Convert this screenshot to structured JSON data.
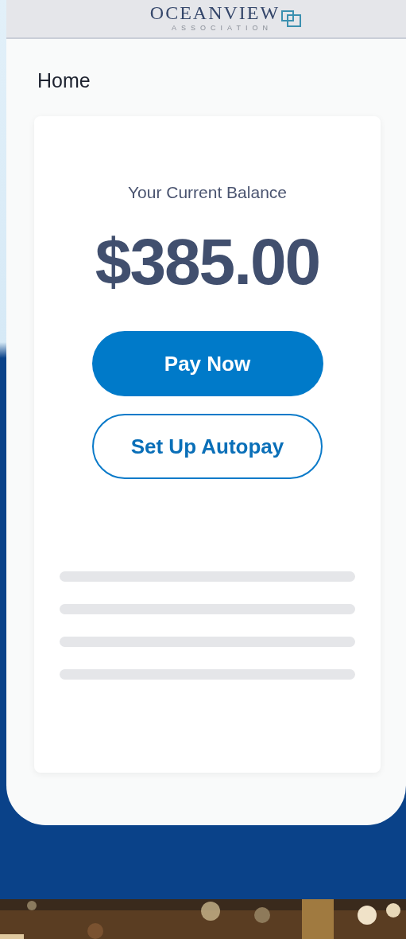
{
  "header": {
    "logo_name": "OCEANVIEW",
    "logo_subtitle": "ASSOCIATION"
  },
  "page_title": "Home",
  "balance": {
    "label": "Your Current Balance",
    "amount": "$385.00"
  },
  "buttons": [
    {
      "label": "Pay Now",
      "kind": "primary"
    },
    {
      "label": "Set Up Autopay",
      "kind": "secondary"
    }
  ]
}
